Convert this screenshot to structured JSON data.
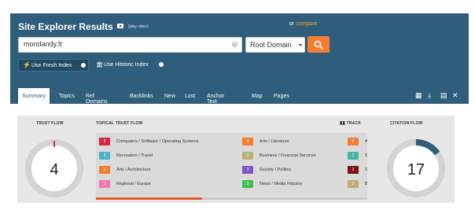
{
  "header": {
    "title": "Site Explorer Results",
    "play_video": "(play video)",
    "or_text": "or",
    "compare_label": "compare"
  },
  "search": {
    "value": "mondandy.fr",
    "scope_value": "Root Domain"
  },
  "index": {
    "fresh_label": "Use Fresh Index",
    "historic_label": "Use Historic Index"
  },
  "tabs": [
    {
      "label": "Summary",
      "active": true
    },
    {
      "label": "Topics"
    },
    {
      "label": "Ref Domains"
    },
    {
      "label": "Backlinks"
    },
    {
      "label": "New"
    },
    {
      "label": "Lost"
    },
    {
      "label": "Anchor Text"
    },
    {
      "label": "Map"
    },
    {
      "label": "Pages"
    }
  ],
  "tool_icons": [
    "compare-chart-icon",
    "download-icon",
    "calculator-icon",
    "tools-icon"
  ],
  "metrics": {
    "trust_flow_label": "TRUST FLOW",
    "trust_flow_value": "4",
    "topical_label": "TOPICAL TRUST FLOW",
    "track_label": "TRACK",
    "citation_flow_label": "CITATION FLOW",
    "citation_flow_value": "17",
    "topics": [
      {
        "score": "3",
        "color": "#d9263d",
        "label": "Computers / Software / Operating Systems"
      },
      {
        "score": "3",
        "color": "#4bb3c8",
        "label": "Recreation / Travel"
      },
      {
        "score": "3",
        "color": "#f47d31",
        "label": "Arts / Architecture"
      },
      {
        "score": "3",
        "color": "#f277ac",
        "label": "Regional / Europe"
      },
      {
        "score": "3",
        "color": "#f47d31",
        "label": "Arts / Literature"
      },
      {
        "score": "3",
        "color": "#b7b179",
        "label": "Business / Financial Services"
      },
      {
        "score": "3",
        "color": "#7b57c9",
        "label": "Society / Politics"
      },
      {
        "score": "3",
        "color": "#44c04c",
        "label": "News / Media Industry"
      }
    ],
    "track": [
      {
        "score": "2",
        "color": "#f47d31",
        "letter": "A"
      },
      {
        "score": "2",
        "color": "#44b6a0",
        "letter": "S"
      },
      {
        "score": "2",
        "color": "#7a0f1a",
        "letter": "S"
      },
      {
        "score": "2",
        "color": "#b7b179",
        "letter": "B"
      }
    ]
  }
}
